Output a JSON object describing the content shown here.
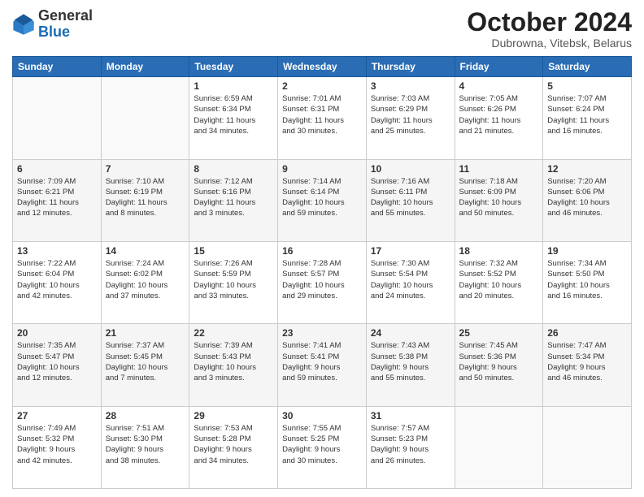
{
  "header": {
    "logo_general": "General",
    "logo_blue": "Blue",
    "month_title": "October 2024",
    "subtitle": "Dubrowna, Vitebsk, Belarus"
  },
  "days_of_week": [
    "Sunday",
    "Monday",
    "Tuesday",
    "Wednesday",
    "Thursday",
    "Friday",
    "Saturday"
  ],
  "weeks": [
    [
      {
        "day": "",
        "content": ""
      },
      {
        "day": "",
        "content": ""
      },
      {
        "day": "1",
        "content": "Sunrise: 6:59 AM\nSunset: 6:34 PM\nDaylight: 11 hours\nand 34 minutes."
      },
      {
        "day": "2",
        "content": "Sunrise: 7:01 AM\nSunset: 6:31 PM\nDaylight: 11 hours\nand 30 minutes."
      },
      {
        "day": "3",
        "content": "Sunrise: 7:03 AM\nSunset: 6:29 PM\nDaylight: 11 hours\nand 25 minutes."
      },
      {
        "day": "4",
        "content": "Sunrise: 7:05 AM\nSunset: 6:26 PM\nDaylight: 11 hours\nand 21 minutes."
      },
      {
        "day": "5",
        "content": "Sunrise: 7:07 AM\nSunset: 6:24 PM\nDaylight: 11 hours\nand 16 minutes."
      }
    ],
    [
      {
        "day": "6",
        "content": "Sunrise: 7:09 AM\nSunset: 6:21 PM\nDaylight: 11 hours\nand 12 minutes."
      },
      {
        "day": "7",
        "content": "Sunrise: 7:10 AM\nSunset: 6:19 PM\nDaylight: 11 hours\nand 8 minutes."
      },
      {
        "day": "8",
        "content": "Sunrise: 7:12 AM\nSunset: 6:16 PM\nDaylight: 11 hours\nand 3 minutes."
      },
      {
        "day": "9",
        "content": "Sunrise: 7:14 AM\nSunset: 6:14 PM\nDaylight: 10 hours\nand 59 minutes."
      },
      {
        "day": "10",
        "content": "Sunrise: 7:16 AM\nSunset: 6:11 PM\nDaylight: 10 hours\nand 55 minutes."
      },
      {
        "day": "11",
        "content": "Sunrise: 7:18 AM\nSunset: 6:09 PM\nDaylight: 10 hours\nand 50 minutes."
      },
      {
        "day": "12",
        "content": "Sunrise: 7:20 AM\nSunset: 6:06 PM\nDaylight: 10 hours\nand 46 minutes."
      }
    ],
    [
      {
        "day": "13",
        "content": "Sunrise: 7:22 AM\nSunset: 6:04 PM\nDaylight: 10 hours\nand 42 minutes."
      },
      {
        "day": "14",
        "content": "Sunrise: 7:24 AM\nSunset: 6:02 PM\nDaylight: 10 hours\nand 37 minutes."
      },
      {
        "day": "15",
        "content": "Sunrise: 7:26 AM\nSunset: 5:59 PM\nDaylight: 10 hours\nand 33 minutes."
      },
      {
        "day": "16",
        "content": "Sunrise: 7:28 AM\nSunset: 5:57 PM\nDaylight: 10 hours\nand 29 minutes."
      },
      {
        "day": "17",
        "content": "Sunrise: 7:30 AM\nSunset: 5:54 PM\nDaylight: 10 hours\nand 24 minutes."
      },
      {
        "day": "18",
        "content": "Sunrise: 7:32 AM\nSunset: 5:52 PM\nDaylight: 10 hours\nand 20 minutes."
      },
      {
        "day": "19",
        "content": "Sunrise: 7:34 AM\nSunset: 5:50 PM\nDaylight: 10 hours\nand 16 minutes."
      }
    ],
    [
      {
        "day": "20",
        "content": "Sunrise: 7:35 AM\nSunset: 5:47 PM\nDaylight: 10 hours\nand 12 minutes."
      },
      {
        "day": "21",
        "content": "Sunrise: 7:37 AM\nSunset: 5:45 PM\nDaylight: 10 hours\nand 7 minutes."
      },
      {
        "day": "22",
        "content": "Sunrise: 7:39 AM\nSunset: 5:43 PM\nDaylight: 10 hours\nand 3 minutes."
      },
      {
        "day": "23",
        "content": "Sunrise: 7:41 AM\nSunset: 5:41 PM\nDaylight: 9 hours\nand 59 minutes."
      },
      {
        "day": "24",
        "content": "Sunrise: 7:43 AM\nSunset: 5:38 PM\nDaylight: 9 hours\nand 55 minutes."
      },
      {
        "day": "25",
        "content": "Sunrise: 7:45 AM\nSunset: 5:36 PM\nDaylight: 9 hours\nand 50 minutes."
      },
      {
        "day": "26",
        "content": "Sunrise: 7:47 AM\nSunset: 5:34 PM\nDaylight: 9 hours\nand 46 minutes."
      }
    ],
    [
      {
        "day": "27",
        "content": "Sunrise: 7:49 AM\nSunset: 5:32 PM\nDaylight: 9 hours\nand 42 minutes."
      },
      {
        "day": "28",
        "content": "Sunrise: 7:51 AM\nSunset: 5:30 PM\nDaylight: 9 hours\nand 38 minutes."
      },
      {
        "day": "29",
        "content": "Sunrise: 7:53 AM\nSunset: 5:28 PM\nDaylight: 9 hours\nand 34 minutes."
      },
      {
        "day": "30",
        "content": "Sunrise: 7:55 AM\nSunset: 5:25 PM\nDaylight: 9 hours\nand 30 minutes."
      },
      {
        "day": "31",
        "content": "Sunrise: 7:57 AM\nSunset: 5:23 PM\nDaylight: 9 hours\nand 26 minutes."
      },
      {
        "day": "",
        "content": ""
      },
      {
        "day": "",
        "content": ""
      }
    ]
  ]
}
